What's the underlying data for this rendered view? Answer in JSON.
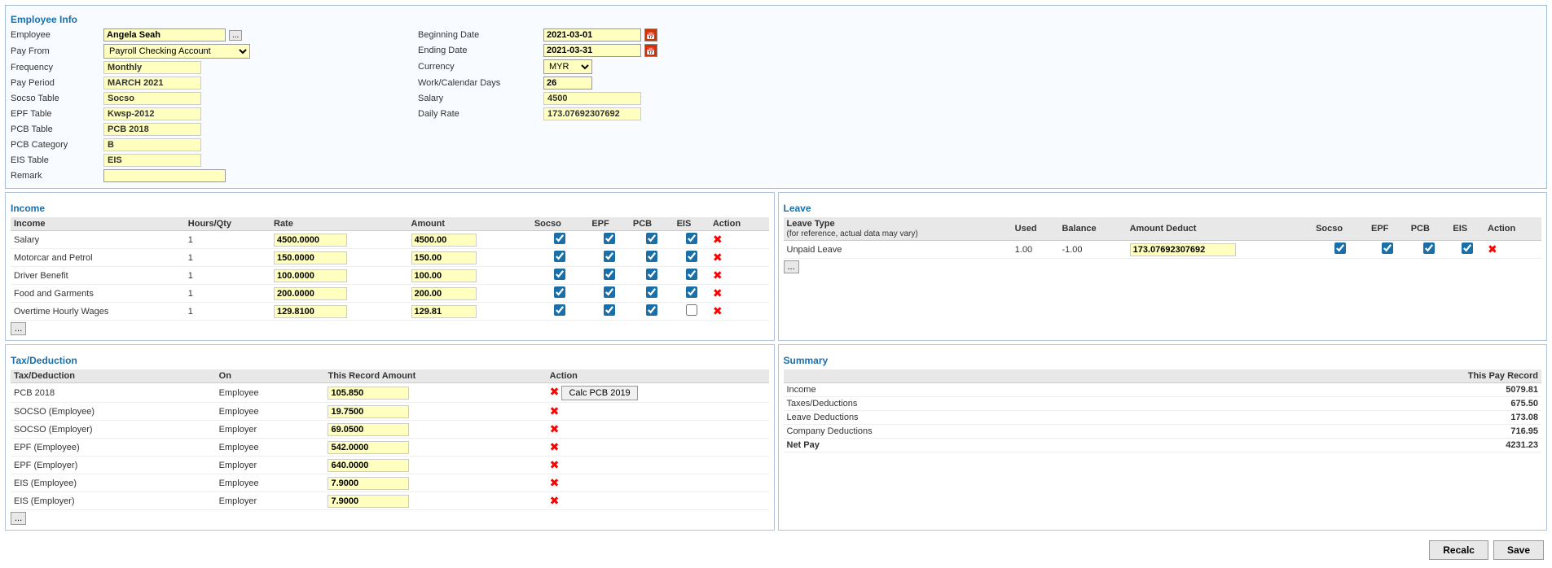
{
  "employeeInfo": {
    "sectionTitle": "Employee Info",
    "employeeLabel": "Employee",
    "employeeValue": "Angela Seah",
    "payFromLabel": "Pay From",
    "payFromValue": "Payroll Checking Account",
    "frequencyLabel": "Frequency",
    "frequencyValue": "Monthly",
    "payPeriodLabel": "Pay Period",
    "payPeriodValue": "MARCH 2021",
    "socsoTableLabel": "Socso Table",
    "socsoTableValue": "Socso",
    "epfTableLabel": "EPF Table",
    "epfTableValue": "Kwsp-2012",
    "pcbTableLabel": "PCB Table",
    "pcbTableValue": "PCB 2018",
    "pcbCategoryLabel": "PCB Category",
    "pcbCategoryValue": "B",
    "eisTableLabel": "EIS Table",
    "eisTableValue": "EIS",
    "remarkLabel": "Remark",
    "remarkValue": "",
    "beginningDateLabel": "Beginning Date",
    "beginningDateValue": "2021-03-01",
    "endingDateLabel": "Ending Date",
    "endingDateValue": "2021-03-31",
    "currencyLabel": "Currency",
    "currencyValue": "MYR",
    "workCalendarDaysLabel": "Work/Calendar Days",
    "workCalendarDaysValue": "26",
    "salaryLabel": "Salary",
    "salaryValue": "4500",
    "dailyRateLabel": "Daily Rate",
    "dailyRateValue": "173.07692307692"
  },
  "income": {
    "sectionTitle": "Income",
    "columns": [
      "Income",
      "Hours/Qty",
      "Rate",
      "Amount",
      "Socso",
      "EPF",
      "PCB",
      "EIS",
      "Action"
    ],
    "rows": [
      {
        "name": "Salary",
        "hours": "1",
        "rate": "4500.0000",
        "amount": "4500.00",
        "socso": true,
        "epf": true,
        "pcb": true,
        "eis": true
      },
      {
        "name": "Motorcar and Petrol",
        "hours": "1",
        "rate": "150.0000",
        "amount": "150.00",
        "socso": true,
        "epf": true,
        "pcb": true,
        "eis": true
      },
      {
        "name": "Driver Benefit",
        "hours": "1",
        "rate": "100.0000",
        "amount": "100.00",
        "socso": true,
        "epf": true,
        "pcb": true,
        "eis": true
      },
      {
        "name": "Food and Garments",
        "hours": "1",
        "rate": "200.0000",
        "amount": "200.00",
        "socso": true,
        "epf": true,
        "pcb": true,
        "eis": true
      },
      {
        "name": "Overtime Hourly Wages",
        "hours": "1",
        "rate": "129.8100",
        "amount": "129.81",
        "socso": true,
        "epf": true,
        "pcb": true,
        "eis": false
      }
    ]
  },
  "leave": {
    "sectionTitle": "Leave",
    "columns": [
      "Leave Type",
      "Used",
      "Balance",
      "Amount Deduct",
      "Socso",
      "EPF",
      "PCB",
      "EIS",
      "Action"
    ],
    "forReference": "(for reference, actual data may vary)",
    "rows": [
      {
        "name": "Unpaid Leave",
        "used": "1.00",
        "balance": "-1.00",
        "amountDeduct": "173.07692307692",
        "socso": true,
        "epf": true,
        "pcb": true,
        "eis": true
      }
    ]
  },
  "taxDeduction": {
    "sectionTitle": "Tax/Deduction",
    "columns": [
      "Tax/Deduction",
      "On",
      "This Record Amount",
      "Action"
    ],
    "rows": [
      {
        "name": "PCB 2018",
        "on": "Employee",
        "amount": "105.850",
        "hasCalcBtn": true,
        "calcBtnLabel": "Calc PCB 2019"
      },
      {
        "name": "SOCSO (Employee)",
        "on": "Employee",
        "amount": "19.7500",
        "hasCalcBtn": false
      },
      {
        "name": "SOCSO (Employer)",
        "on": "Employer",
        "amount": "69.0500",
        "hasCalcBtn": false
      },
      {
        "name": "EPF (Employee)",
        "on": "Employee",
        "amount": "542.0000",
        "hasCalcBtn": false
      },
      {
        "name": "EPF (Employer)",
        "on": "Employer",
        "amount": "640.0000",
        "hasCalcBtn": false
      },
      {
        "name": "EIS (Employee)",
        "on": "Employee",
        "amount": "7.9000",
        "hasCalcBtn": false
      },
      {
        "name": "EIS (Employer)",
        "on": "Employer",
        "amount": "7.9000",
        "hasCalcBtn": false
      }
    ]
  },
  "summary": {
    "sectionTitle": "Summary",
    "thisPayRecordLabel": "This Pay Record",
    "rows": [
      {
        "label": "Income",
        "value": "5079.81"
      },
      {
        "label": "Taxes/Deductions",
        "value": "675.50"
      },
      {
        "label": "Leave Deductions",
        "value": "173.08"
      },
      {
        "label": "Company Deductions",
        "value": "716.95"
      },
      {
        "label": "Net Pay",
        "value": "4231.23"
      }
    ]
  },
  "buttons": {
    "recalcLabel": "Recalc",
    "saveLabel": "Save"
  }
}
